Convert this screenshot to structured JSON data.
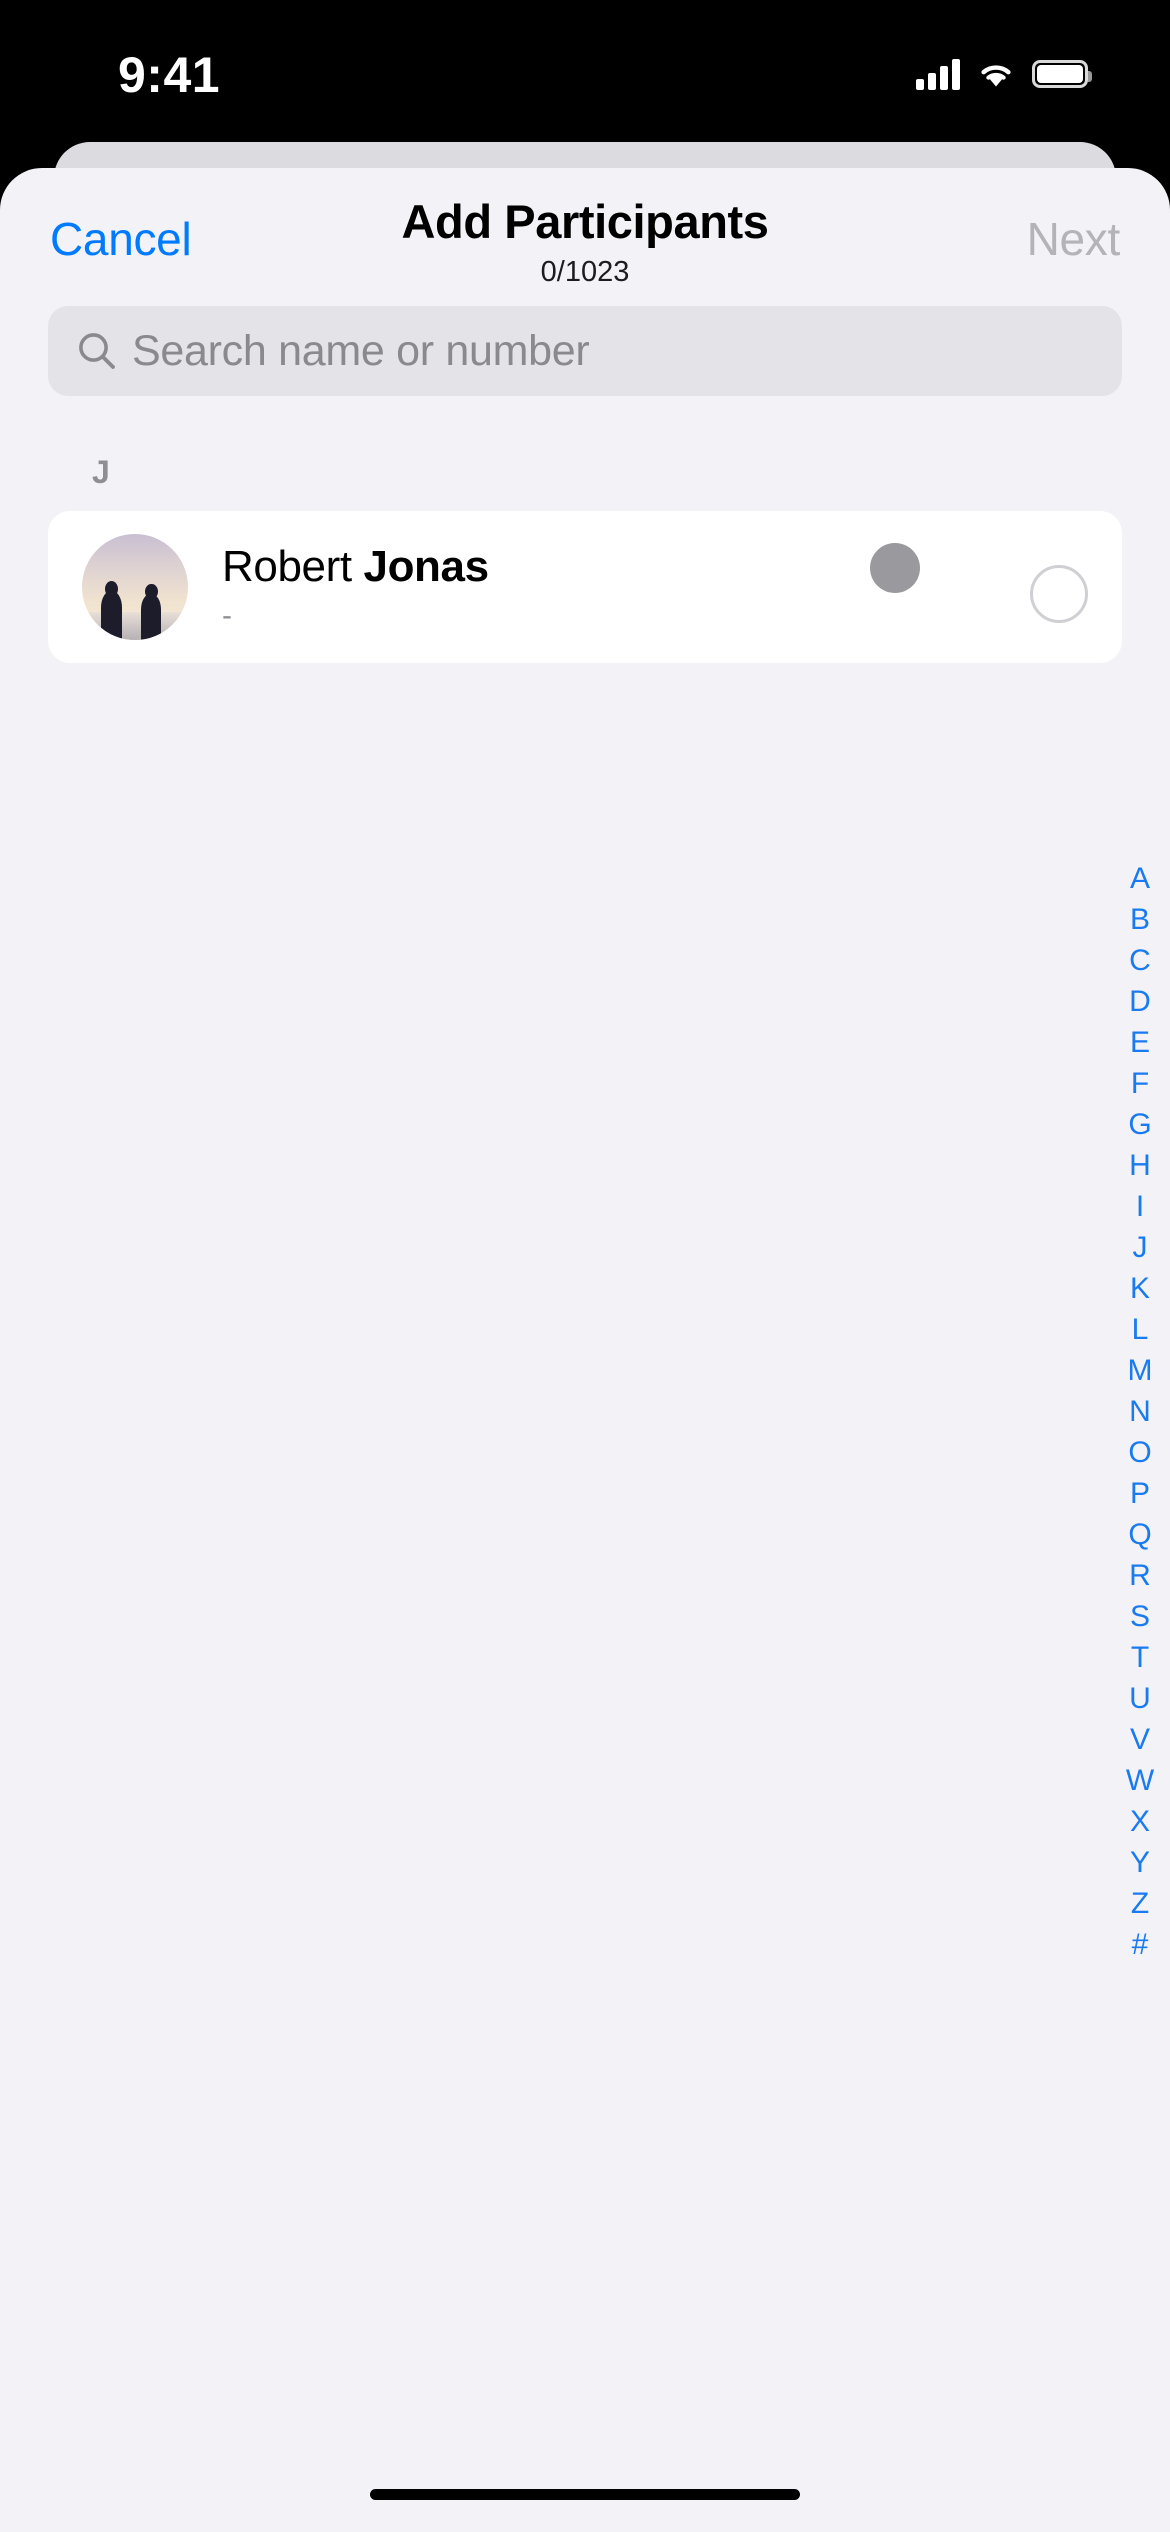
{
  "status_bar": {
    "time": "9:41",
    "cellular_icon": "cellular-bars-icon",
    "wifi_icon": "wifi-icon",
    "battery_icon": "battery-icon"
  },
  "nav": {
    "cancel_label": "Cancel",
    "title": "Add Participants",
    "subtitle": "0/1023",
    "next_label": "Next",
    "cancel_color": "#007aff",
    "next_color": "#b3b3b8"
  },
  "search": {
    "icon": "search-icon",
    "placeholder": "Search name or number",
    "value": ""
  },
  "contacts": {
    "section_letter": "J",
    "items": [
      {
        "first_name": "Robert",
        "last_name": "Jonas",
        "subtitle": "-",
        "avatar": "photo-avatar-sunset-silhouettes",
        "status_dot": "presence-dot",
        "selected": false,
        "select_icon": "unchecked-circle-icon"
      }
    ]
  },
  "index_rail": {
    "letters": [
      "A",
      "B",
      "C",
      "D",
      "E",
      "F",
      "G",
      "H",
      "I",
      "J",
      "K",
      "L",
      "M",
      "N",
      "O",
      "P",
      "Q",
      "R",
      "S",
      "T",
      "U",
      "V",
      "W",
      "X",
      "Y",
      "Z",
      "#"
    ],
    "color": "#1a7aef"
  },
  "home_indicator": "home-indicator"
}
